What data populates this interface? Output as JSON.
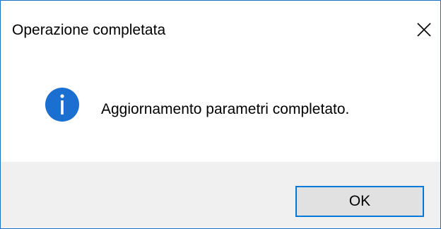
{
  "window": {
    "title": "Operazione completata",
    "close_icon": "close-icon"
  },
  "content": {
    "icon": "info-icon",
    "message": "Aggiornamento parametri completato."
  },
  "footer": {
    "ok_label": "OK"
  },
  "colors": {
    "accent": "#0078d7",
    "info_icon_bg": "#1a6fd0",
    "footer_bg": "#f0f0f0",
    "button_bg": "#e1e1e1"
  }
}
